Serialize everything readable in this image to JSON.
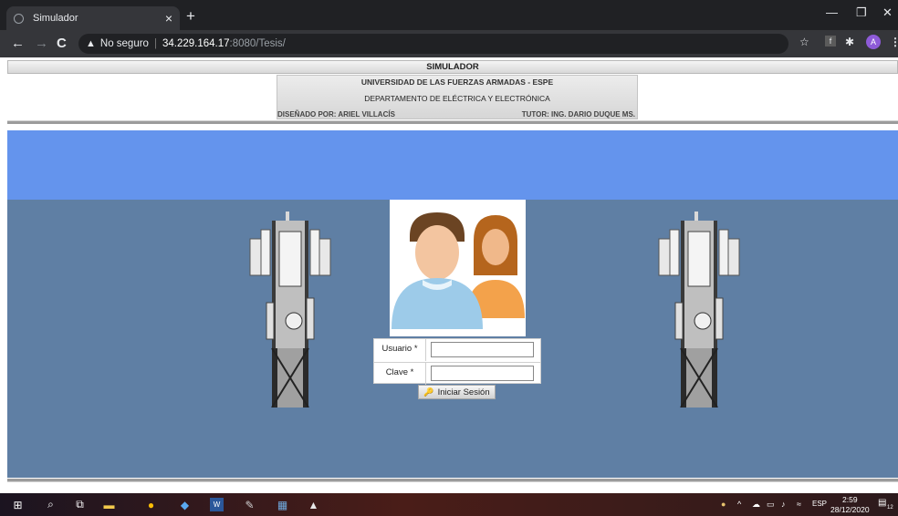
{
  "browser": {
    "tab_title": "Simulador",
    "tab_close": "×",
    "new_tab": "+",
    "security_label": "No seguro",
    "url_host": "34.229.164.17",
    "url_path": ":8080/Tesis/",
    "profile_initial": "A"
  },
  "header": {
    "title": "SIMULADOR",
    "university": "UNIVERSIDAD DE LAS FUERZAS ARMADAS - ESPE",
    "department": "DEPARTAMENTO DE ELÉCTRICA Y ELECTRÓNICA",
    "designer": "DISEÑADO POR: ARIEL VILLACÍS",
    "tutor": "TUTOR: ING. DARIO DUQUE MS."
  },
  "login": {
    "user_label": "Usuario *",
    "user_value": "",
    "password_label": "Clave *",
    "password_value": "",
    "submit_label": "Iniciar Sesión"
  },
  "taskbar": {
    "language": "ESP",
    "time": "2:59",
    "date": "28/12/2020",
    "notifications": "12"
  },
  "colors": {
    "blue_band": "#6494ed",
    "main_bg": "#5f7fa4",
    "browser_dark": "#202124"
  }
}
